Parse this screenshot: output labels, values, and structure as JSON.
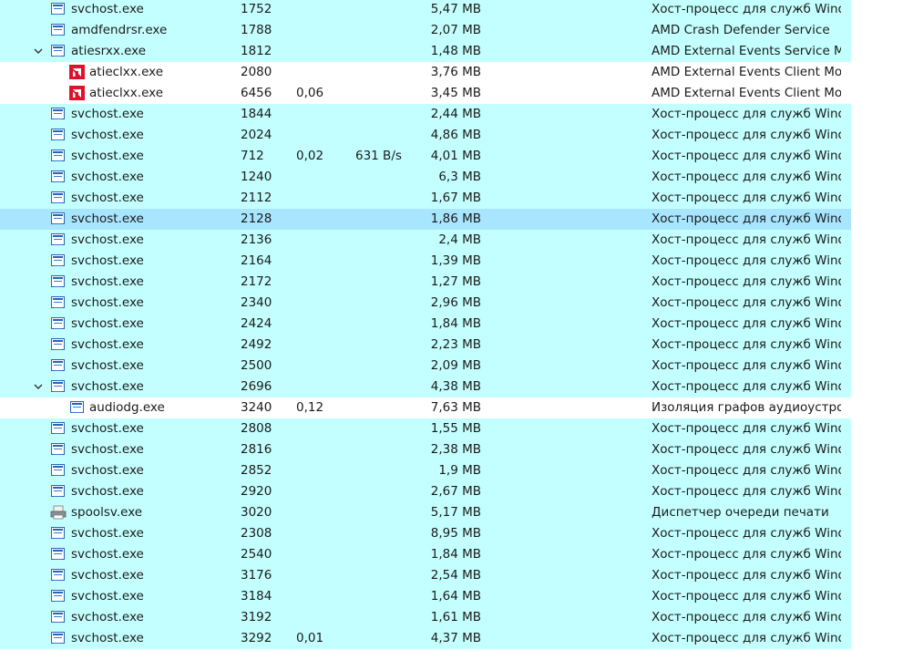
{
  "processes": [
    {
      "name": "svchost.exe",
      "pid": "1752",
      "cpu": "",
      "disk": "",
      "memory": "5,47 MB",
      "description": "Хост-процесс для служб Windows",
      "icon": "service-window-icon",
      "level": 0,
      "expand": false,
      "bg": "svc"
    },
    {
      "name": "amdfendrsr.exe",
      "pid": "1788",
      "cpu": "",
      "disk": "",
      "memory": "2,07 MB",
      "description": "AMD Crash Defender Service",
      "icon": "service-window-icon",
      "level": 0,
      "expand": false,
      "bg": "svc"
    },
    {
      "name": "atiesrxx.exe",
      "pid": "1812",
      "cpu": "",
      "disk": "",
      "memory": "1,48 MB",
      "description": "AMD External Events Service Module",
      "icon": "service-window-icon",
      "level": 0,
      "expand": true,
      "bg": "svc"
    },
    {
      "name": "atieclxx.exe",
      "pid": "2080",
      "cpu": "",
      "disk": "",
      "memory": "3,76 MB",
      "description": "AMD External Events Client Module",
      "icon": "amd-logo-icon",
      "level": 1,
      "expand": false,
      "bg": "white"
    },
    {
      "name": "atieclxx.exe",
      "pid": "6456",
      "cpu": "0,06",
      "disk": "",
      "memory": "3,45 MB",
      "description": "AMD External Events Client Module",
      "icon": "amd-logo-icon",
      "level": 1,
      "expand": false,
      "bg": "white"
    },
    {
      "name": "svchost.exe",
      "pid": "1844",
      "cpu": "",
      "disk": "",
      "memory": "2,44 MB",
      "description": "Хост-процесс для служб Windows",
      "icon": "service-window-icon",
      "level": 0,
      "expand": false,
      "bg": "svc"
    },
    {
      "name": "svchost.exe",
      "pid": "2024",
      "cpu": "",
      "disk": "",
      "memory": "4,86 MB",
      "description": "Хост-процесс для служб Windows",
      "icon": "service-window-icon",
      "level": 0,
      "expand": false,
      "bg": "svc"
    },
    {
      "name": "svchost.exe",
      "pid": "712",
      "cpu": "0,02",
      "disk": "631 B/s",
      "memory": "4,01 MB",
      "description": "Хост-процесс для служб Windows",
      "icon": "service-window-icon",
      "level": 0,
      "expand": false,
      "bg": "svc"
    },
    {
      "name": "svchost.exe",
      "pid": "1240",
      "cpu": "",
      "disk": "",
      "memory": "6,3 MB",
      "description": "Хост-процесс для служб Windows",
      "icon": "service-window-icon",
      "level": 0,
      "expand": false,
      "bg": "svc"
    },
    {
      "name": "svchost.exe",
      "pid": "2112",
      "cpu": "",
      "disk": "",
      "memory": "1,67 MB",
      "description": "Хост-процесс для служб Windows",
      "icon": "service-window-icon",
      "level": 0,
      "expand": false,
      "bg": "svc"
    },
    {
      "name": "svchost.exe",
      "pid": "2128",
      "cpu": "",
      "disk": "",
      "memory": "1,86 MB",
      "description": "Хост-процесс для служб Windows",
      "icon": "service-window-icon",
      "level": 0,
      "expand": false,
      "bg": "selected"
    },
    {
      "name": "svchost.exe",
      "pid": "2136",
      "cpu": "",
      "disk": "",
      "memory": "2,4 MB",
      "description": "Хост-процесс для служб Windows",
      "icon": "service-window-icon",
      "level": 0,
      "expand": false,
      "bg": "svc"
    },
    {
      "name": "svchost.exe",
      "pid": "2164",
      "cpu": "",
      "disk": "",
      "memory": "1,39 MB",
      "description": "Хост-процесс для служб Windows",
      "icon": "service-window-icon",
      "level": 0,
      "expand": false,
      "bg": "svc"
    },
    {
      "name": "svchost.exe",
      "pid": "2172",
      "cpu": "",
      "disk": "",
      "memory": "1,27 MB",
      "description": "Хост-процесс для служб Windows",
      "icon": "service-window-icon",
      "level": 0,
      "expand": false,
      "bg": "svc"
    },
    {
      "name": "svchost.exe",
      "pid": "2340",
      "cpu": "",
      "disk": "",
      "memory": "2,96 MB",
      "description": "Хост-процесс для служб Windows",
      "icon": "service-window-icon",
      "level": 0,
      "expand": false,
      "bg": "svc"
    },
    {
      "name": "svchost.exe",
      "pid": "2424",
      "cpu": "",
      "disk": "",
      "memory": "1,84 MB",
      "description": "Хост-процесс для служб Windows",
      "icon": "service-window-icon",
      "level": 0,
      "expand": false,
      "bg": "svc"
    },
    {
      "name": "svchost.exe",
      "pid": "2492",
      "cpu": "",
      "disk": "",
      "memory": "2,23 MB",
      "description": "Хост-процесс для служб Windows",
      "icon": "service-window-icon",
      "level": 0,
      "expand": false,
      "bg": "svc"
    },
    {
      "name": "svchost.exe",
      "pid": "2500",
      "cpu": "",
      "disk": "",
      "memory": "2,09 MB",
      "description": "Хост-процесс для служб Windows",
      "icon": "service-window-icon",
      "level": 0,
      "expand": false,
      "bg": "svc"
    },
    {
      "name": "svchost.exe",
      "pid": "2696",
      "cpu": "",
      "disk": "",
      "memory": "4,38 MB",
      "description": "Хост-процесс для служб Windows",
      "icon": "service-window-icon",
      "level": 0,
      "expand": true,
      "bg": "svc"
    },
    {
      "name": "audiodg.exe",
      "pid": "3240",
      "cpu": "0,12",
      "disk": "",
      "memory": "7,63 MB",
      "description": "Изоляция графов аудиоустройств",
      "icon": "service-window-icon",
      "level": 1,
      "expand": false,
      "bg": "white"
    },
    {
      "name": "svchost.exe",
      "pid": "2808",
      "cpu": "",
      "disk": "",
      "memory": "1,55 MB",
      "description": "Хост-процесс для служб Windows",
      "icon": "service-window-icon",
      "level": 0,
      "expand": false,
      "bg": "svc"
    },
    {
      "name": "svchost.exe",
      "pid": "2816",
      "cpu": "",
      "disk": "",
      "memory": "2,38 MB",
      "description": "Хост-процесс для служб Windows",
      "icon": "service-window-icon",
      "level": 0,
      "expand": false,
      "bg": "svc"
    },
    {
      "name": "svchost.exe",
      "pid": "2852",
      "cpu": "",
      "disk": "",
      "memory": "1,9 MB",
      "description": "Хост-процесс для служб Windows",
      "icon": "service-window-icon",
      "level": 0,
      "expand": false,
      "bg": "svc"
    },
    {
      "name": "svchost.exe",
      "pid": "2920",
      "cpu": "",
      "disk": "",
      "memory": "2,67 MB",
      "description": "Хост-процесс для служб Windows",
      "icon": "service-window-icon",
      "level": 0,
      "expand": false,
      "bg": "svc"
    },
    {
      "name": "spoolsv.exe",
      "pid": "3020",
      "cpu": "",
      "disk": "",
      "memory": "5,17 MB",
      "description": "Диспетчер очереди печати",
      "icon": "printer-icon",
      "level": 0,
      "expand": false,
      "bg": "svc"
    },
    {
      "name": "svchost.exe",
      "pid": "2308",
      "cpu": "",
      "disk": "",
      "memory": "8,95 MB",
      "description": "Хост-процесс для служб Windows",
      "icon": "service-window-icon",
      "level": 0,
      "expand": false,
      "bg": "svc"
    },
    {
      "name": "svchost.exe",
      "pid": "2540",
      "cpu": "",
      "disk": "",
      "memory": "1,84 MB",
      "description": "Хост-процесс для служб Windows",
      "icon": "service-window-icon",
      "level": 0,
      "expand": false,
      "bg": "svc"
    },
    {
      "name": "svchost.exe",
      "pid": "3176",
      "cpu": "",
      "disk": "",
      "memory": "2,54 MB",
      "description": "Хост-процесс для служб Windows",
      "icon": "service-window-icon",
      "level": 0,
      "expand": false,
      "bg": "svc"
    },
    {
      "name": "svchost.exe",
      "pid": "3184",
      "cpu": "",
      "disk": "",
      "memory": "1,64 MB",
      "description": "Хост-процесс для служб Windows",
      "icon": "service-window-icon",
      "level": 0,
      "expand": false,
      "bg": "svc"
    },
    {
      "name": "svchost.exe",
      "pid": "3192",
      "cpu": "",
      "disk": "",
      "memory": "1,61 MB",
      "description": "Хост-процесс для служб Windows",
      "icon": "service-window-icon",
      "level": 0,
      "expand": false,
      "bg": "svc"
    },
    {
      "name": "svchost.exe",
      "pid": "3292",
      "cpu": "0,01",
      "disk": "",
      "memory": "4,37 MB",
      "description": "Хост-процесс для служб Windows",
      "icon": "service-window-icon",
      "level": 0,
      "expand": false,
      "bg": "svc"
    }
  ],
  "colors": {
    "service_row_bg": "#c4ffff",
    "selected_row_bg": "#a8e6ff",
    "child_row_bg": "#ffffff",
    "amd_red": "#e0112b",
    "service_icon_blue": "#2a64b8"
  }
}
